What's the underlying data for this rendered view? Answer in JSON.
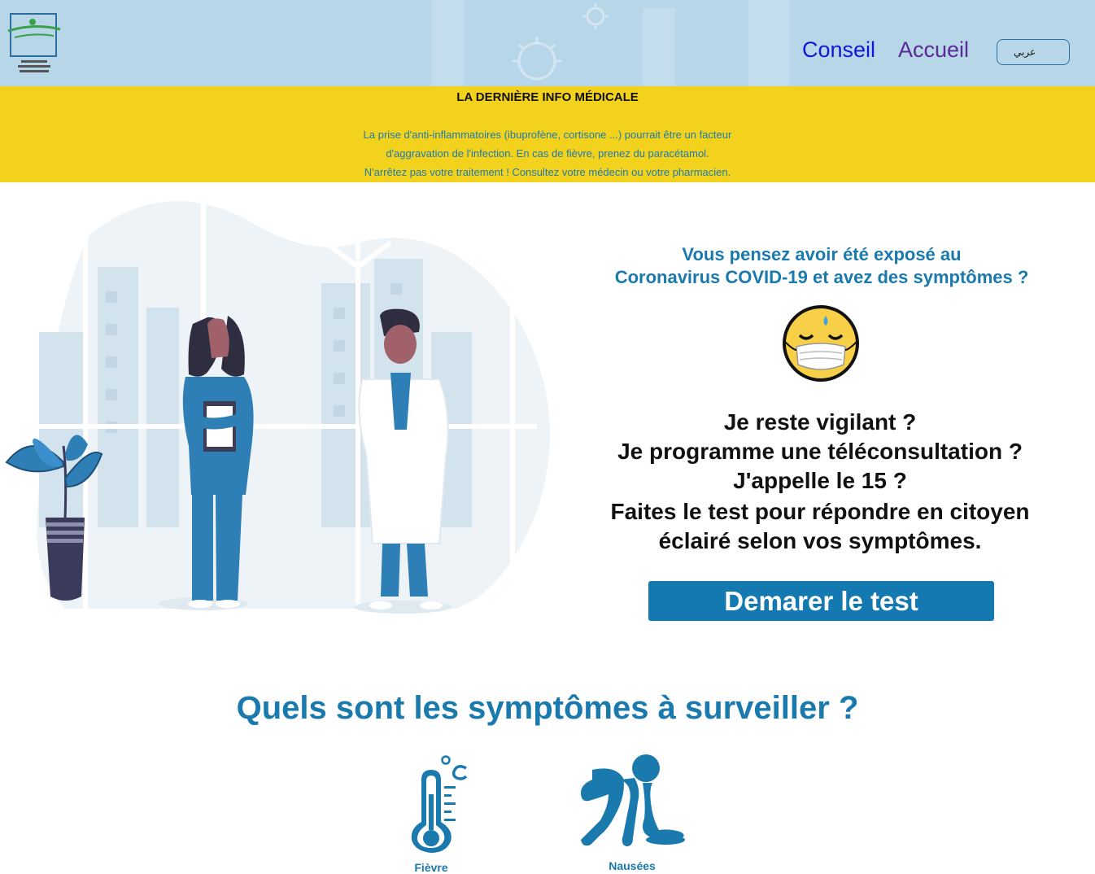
{
  "header": {
    "nav": {
      "conseil": "Conseil",
      "accueil": "Accueil"
    },
    "language_button": "عربي"
  },
  "banner": {
    "title": "LA DERNIÈRE INFO MÉDICALE",
    "lines": [
      "La prise d'anti-inflammatoires (ibuprofène, cortisone ...) pourrait être un facteur",
      "d'aggravation de l'infection. En cas de fièvre, prenez du paracétamol.",
      "N'arrêtez pas votre traitement ! Consultez votre médecin ou votre pharmacien."
    ]
  },
  "hero": {
    "question_lines": [
      "Vous pensez avoir été exposé au",
      "Coronavirus COVID-19 et avez des symptômes ?"
    ],
    "cta_lines": [
      "Je reste vigilant ?",
      "Je programme une téléconsultation ?",
      "J'appelle le 15 ?",
      "Faites le test pour répondre en citoyen",
      "éclairé selon vos symptômes."
    ],
    "start_button": "Demarer le test"
  },
  "symptoms": {
    "title": "Quels sont les symptômes à surveiller ?",
    "items": [
      {
        "icon": "thermometer-icon",
        "label": "Fièvre"
      },
      {
        "icon": "vomiting-person-icon",
        "label": "Nausées"
      }
    ]
  },
  "colors": {
    "header_bg": "#b7d6e8",
    "banner_bg": "#f2d21c",
    "accent_blue": "#1a79ad",
    "button_blue": "#1379b0"
  }
}
